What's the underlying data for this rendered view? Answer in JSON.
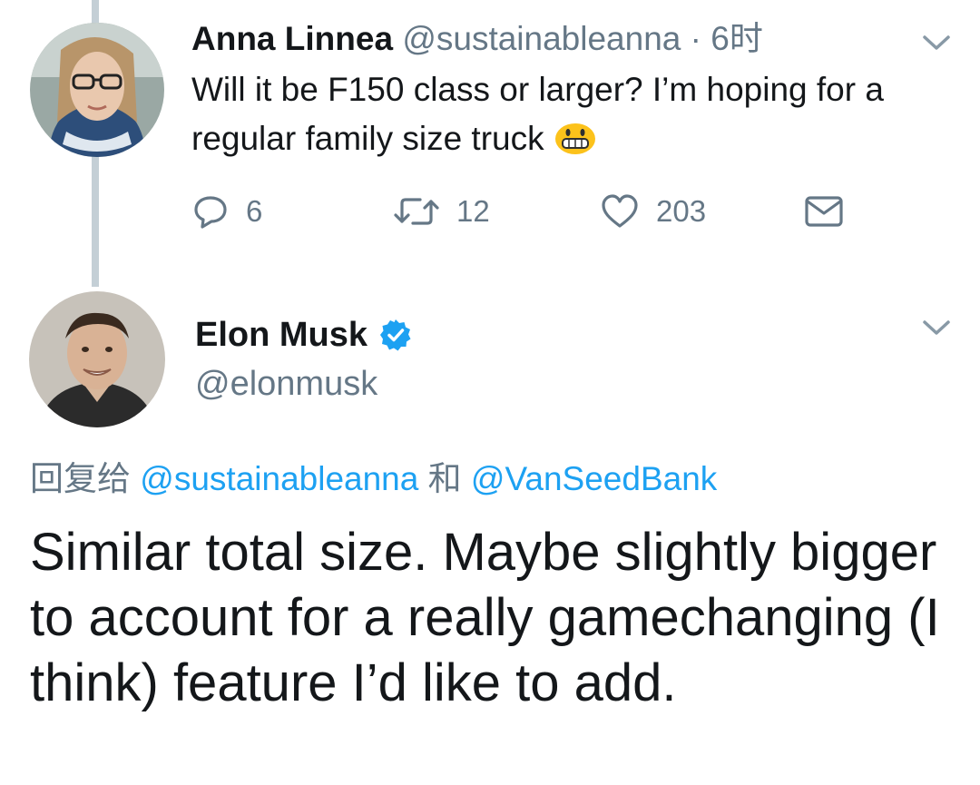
{
  "reply_tweet": {
    "author_name": "Anna Linnea",
    "author_handle": "@sustainableanna",
    "separator": "·",
    "timestamp": "6时",
    "text": "Will it be F150 class or larger? I’m hoping for a regular family size truck",
    "emoji": "grinning-face-emoji",
    "actions": {
      "reply_count": "6",
      "retweet_count": "12",
      "like_count": "203"
    }
  },
  "main_tweet": {
    "author_name": "Elon Musk",
    "author_handle": "@elonmusk",
    "verified": true,
    "replying_to_label": "回复给",
    "replying_to_mentions": [
      "@sustainableanna",
      "@VanSeedBank"
    ],
    "replying_to_conjunction": "和",
    "text": "Similar total size. Maybe slightly bigger to account for a really gamechanging (I think) feature I’d like to add."
  },
  "colors": {
    "link_blue": "#1da1f2",
    "muted_gray": "#657786",
    "text_dark": "#14171a",
    "thread_line": "#c4cfd6"
  }
}
